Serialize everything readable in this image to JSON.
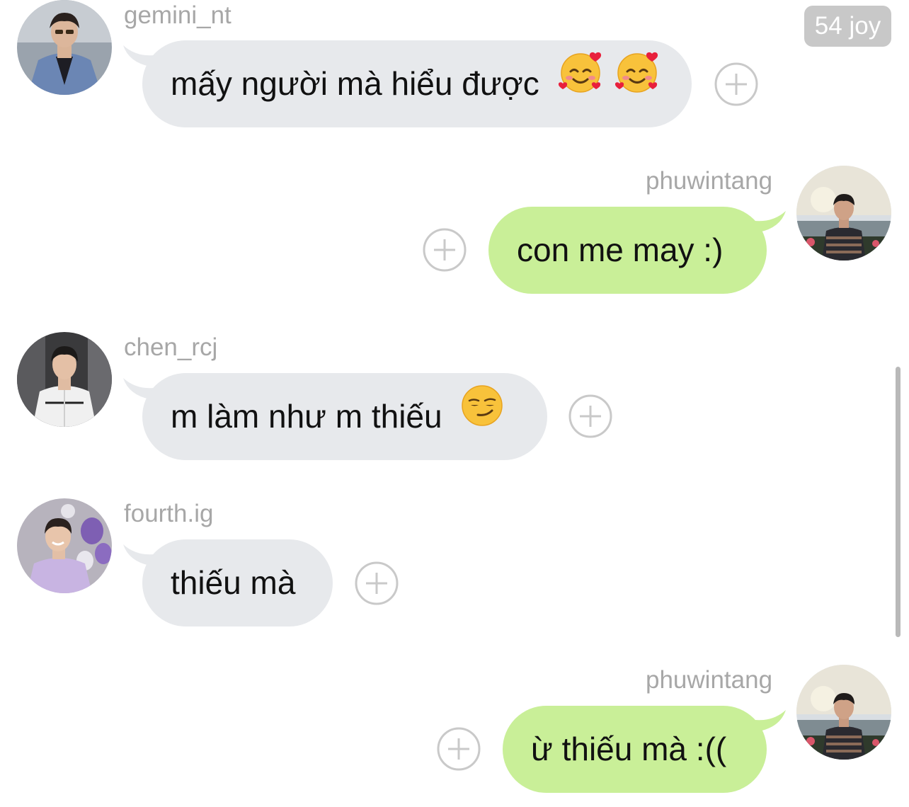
{
  "time_badge": "54 joy",
  "messages": [
    {
      "username": "gemini_nt",
      "text": "mấy người mà hiểu được",
      "side": "incoming"
    },
    {
      "username": "phuwintang",
      "text": "con me may :)",
      "side": "outgoing"
    },
    {
      "username": "chen_rcj",
      "text": "m làm như m thiếu",
      "side": "incoming"
    },
    {
      "username": "fourth.ig",
      "text": "thiếu mà",
      "side": "incoming"
    },
    {
      "username": "phuwintang",
      "text": "ừ thiếu mà :((",
      "side": "outgoing"
    }
  ],
  "icons": {
    "reaction_add": "plus-circle-icon",
    "emoji_love": "smiling-face-with-hearts-icon",
    "emoji_smirk": "smirking-face-icon"
  },
  "colors": {
    "incoming_bubble": "#e7e9ec",
    "outgoing_bubble": "#c9ef98",
    "username_text": "#a7a7a7",
    "plus_icon": "#c9c9c9",
    "time_badge": "#c8c8c8"
  }
}
